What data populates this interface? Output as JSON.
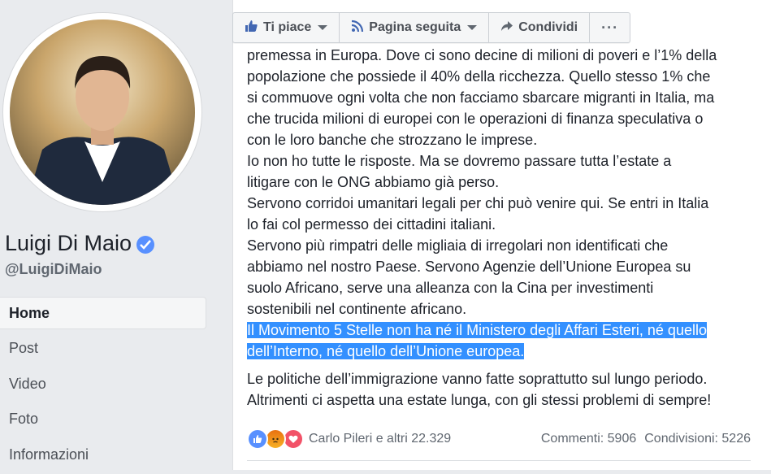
{
  "profile": {
    "name": "Luigi Di Maio",
    "handle": "@LuigiDiMaio"
  },
  "nav": {
    "items": [
      {
        "label": "Home",
        "active": true
      },
      {
        "label": "Post"
      },
      {
        "label": "Video"
      },
      {
        "label": "Foto"
      },
      {
        "label": "Informazioni"
      }
    ]
  },
  "actions": {
    "like_label": "Ti piace",
    "follow_label": "Pagina seguita",
    "share_label": "Condividi",
    "more_label": "···"
  },
  "post": {
    "lines": [
      "premessa in Europa. Dove ci sono decine di milioni di poveri e l’1% della",
      "popolazione che possiede il 40% della ricchezza. Quello stesso 1% che",
      "si commuove ogni volta che non facciamo sbarcare migranti in Italia, ma",
      "che trucida milioni di europei con le operazioni di finanza speculativa o",
      "con le loro banche che strozzano le imprese.",
      "Io non ho tutte le risposte. Ma se dovremo passare tutta l’estate a",
      "litigare con le ONG abbiamo già perso.",
      "Servono corridoi umanitari legali per chi può venire qui. Se entri in Italia",
      "lo fai col permesso dei cittadini italiani.",
      "Servono più rimpatri delle migliaia di irregolari non identificati che",
      "abbiamo nel nostro Paese. Servono Agenzie dell’Unione Europea su",
      "suolo Africano, serve una alleanza con la Cina per investimenti",
      "sostenibili nel continente africano."
    ],
    "highlighted": [
      "Il Movimento 5 Stelle non ha né il Ministero degli Affari Esteri, né quello",
      "dell’Interno, né quello dell’Unione europea."
    ],
    "closing": [
      "Le politiche dell’immigrazione vanno fatte soprattutto sul lungo periodo.",
      "Altrimenti ci aspetta una estate lunga, con gli stessi problemi di sempre!"
    ]
  },
  "footer": {
    "reactors": "Carlo Pileri e altri 22.329",
    "comments": "Commenti: 5906",
    "shares": "Condivisioni: 5226"
  },
  "colors": {
    "accent": "#5890ff",
    "highlight": "#3390ff",
    "background": "#e9ebee"
  }
}
